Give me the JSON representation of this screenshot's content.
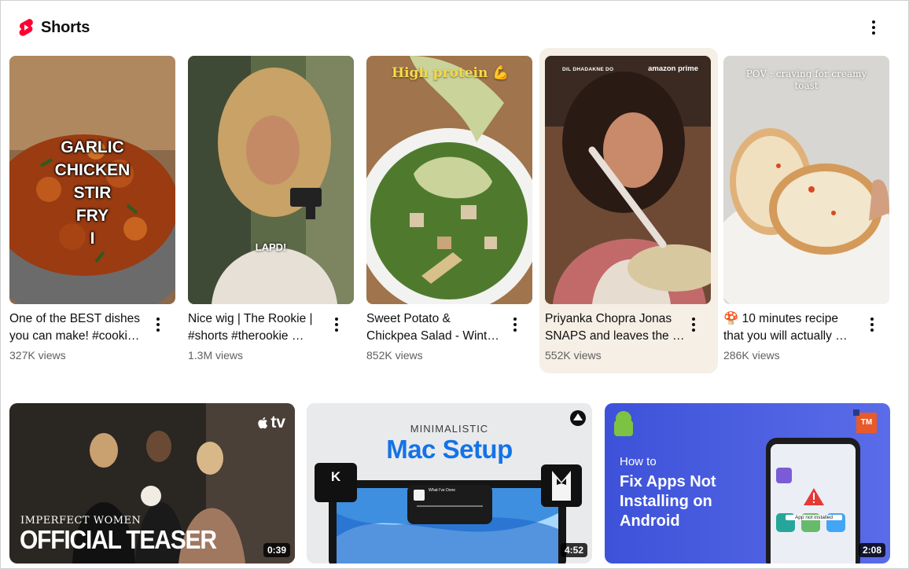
{
  "shelf": {
    "title": "Shorts",
    "menu_icon": "more-vert-icon",
    "logo_icon": "youtube-shorts-icon",
    "brand_color": "#ff0033"
  },
  "shorts": [
    {
      "thumb_text": [
        "GARLIC",
        "CHICKEN",
        "STIR",
        "FRY",
        "I"
      ],
      "title_lines": [
        "One of the BEST dishes",
        "you can make! #cooki…"
      ],
      "views": "327K views"
    },
    {
      "thumb_text": [
        "LAPD!"
      ],
      "title_lines": [
        "Nice wig | The Rookie |",
        "#shorts #therookie …"
      ],
      "views": "1.3M views"
    },
    {
      "thumb_text": [
        "High protein 💪"
      ],
      "title_lines": [
        "Sweet Potato &",
        "Chickpea Salad - Wint…"
      ],
      "views": "852K views"
    },
    {
      "thumb_text": [
        "DIL DHADAKNE DO",
        "amazon prime"
      ],
      "title_lines": [
        "Priyanka Chopra Jonas",
        "SNAPS and leaves the …"
      ],
      "views": "552K views",
      "hovered": true
    },
    {
      "thumb_text": [
        "POV : craving for creamy",
        "toast"
      ],
      "title_lines": [
        "🍄 10 minutes recipe",
        "that you will actually …"
      ],
      "views": "286K views"
    }
  ],
  "videos": [
    {
      "duration": "0:39",
      "overlay_small": "IMPERFECT WOMEN",
      "overlay_big": "OFFICIAL TEASER",
      "badge": "tv"
    },
    {
      "duration": "4:52",
      "overlay_small": "MINIMALISTIC",
      "overlay_big": "Mac Setup",
      "key_label": "K",
      "player_title": "What I've Done"
    },
    {
      "duration": "2:08",
      "overlay_small": "How to",
      "overlay_big_lines": [
        "Fix Apps Not",
        "Installing on",
        "Android"
      ],
      "badge": "TM",
      "phone_text": "App not installed"
    }
  ]
}
